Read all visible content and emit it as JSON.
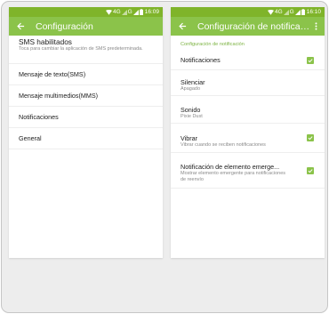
{
  "left": {
    "status": {
      "network": "4G",
      "network2": "G",
      "time": "16:09"
    },
    "appbar": {
      "title": "Configuración"
    },
    "items": [
      {
        "primary": "SMS habilitados",
        "secondary": "Toca para cambiar la aplicación de SMS predeterminada."
      },
      {
        "primary": "Mensaje de texto(SMS)"
      },
      {
        "primary": "Mensaje multimedios(MMS)"
      },
      {
        "primary": "Notificaciones"
      },
      {
        "primary": "General"
      }
    ]
  },
  "right": {
    "status": {
      "network": "4G",
      "network2": "G",
      "time": "16:10"
    },
    "appbar": {
      "title": "Configuración de notificaci..."
    },
    "section_header": "Configuración de notificación",
    "items": [
      {
        "primary": "Notificaciones",
        "checked": true
      },
      {
        "primary": "Silenciar",
        "secondary": "Apagado"
      },
      {
        "primary": "Sonido",
        "secondary": "Pixie Dust"
      },
      {
        "primary": "Vibrar",
        "secondary": "Vibrar cuando se reciben notificaciones",
        "checked": true
      },
      {
        "primary": "Notificación de elemento emerge...",
        "secondary": "Mostrar elemento emergente para notificaciones de reenvío",
        "checked": true
      }
    ]
  },
  "colors": {
    "statusbar": "#7fb42a",
    "appbar": "#8bc34a",
    "accent": "#7cb342"
  },
  "icons": [
    "wifi-icon",
    "signal-icon",
    "battery-icon",
    "back-arrow-icon",
    "more-vert-icon",
    "checkbox-checked-icon"
  ]
}
